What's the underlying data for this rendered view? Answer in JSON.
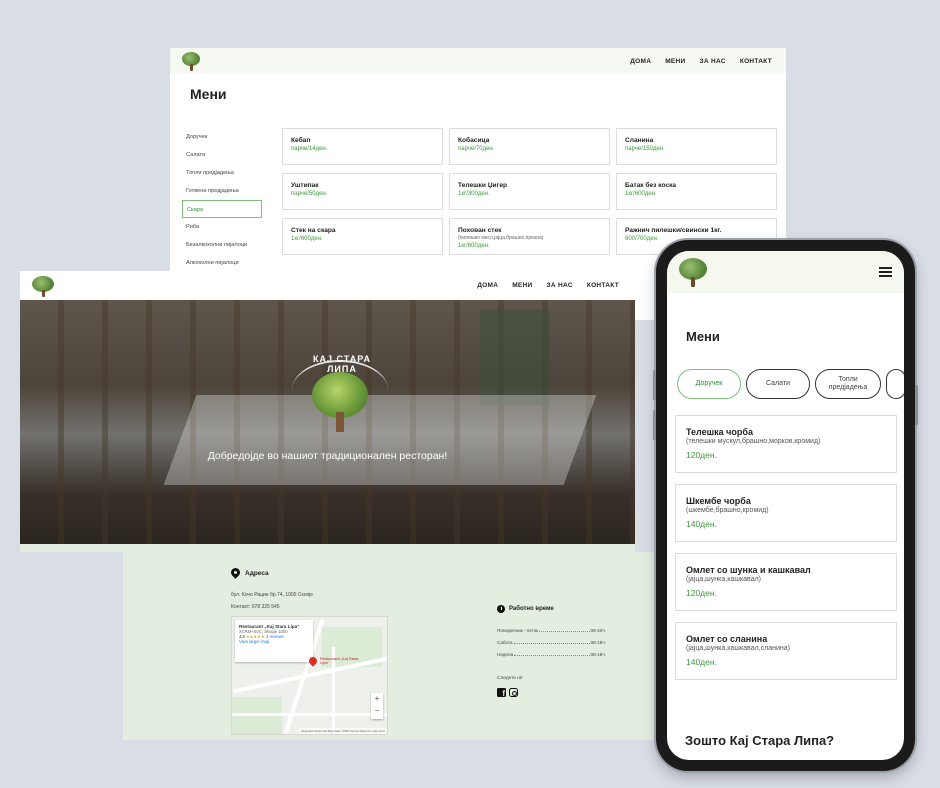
{
  "nav": [
    "ДОМА",
    "МЕНИ",
    "ЗА НАС",
    "КОНТАКТ"
  ],
  "desktop_menu": {
    "title": "Мени",
    "categories": [
      "Доручек",
      "Салати",
      "Топли предјадења",
      "Готвени предјадења",
      "Скара",
      "Риба",
      "Безалкохолни пијалоци",
      "Алкохолни пијалоци"
    ],
    "active_category": "Скара",
    "items": [
      {
        "name": "Кебап",
        "desc": "",
        "price": "парче/14ден."
      },
      {
        "name": "Кобасица",
        "desc": "",
        "price": "парче/70ден."
      },
      {
        "name": "Сланина",
        "desc": "",
        "price": "парче/150ден."
      },
      {
        "name": "Уштипак",
        "desc": "",
        "price": "парче/50ден."
      },
      {
        "name": "Телешки Џигер",
        "desc": "",
        "price": "1кг/300ден."
      },
      {
        "name": "Батак без коска",
        "desc": "",
        "price": "1кг/600ден."
      },
      {
        "name": "Стек на скара",
        "desc": "",
        "price": "1кг/600ден."
      },
      {
        "name": "Похован стек",
        "desc": "(пилешко месо,јајца,брашно,презла)",
        "price": "1кг/600ден."
      },
      {
        "name": "Ражнич пилешки/свински 1кг.",
        "desc": "",
        "price": "600/700ден."
      }
    ]
  },
  "hero": {
    "logo_text": "КАЈ СТАРА ЛИПА",
    "welcome": "Добредојде во нашиот традиционален ресторан!"
  },
  "footer": {
    "address_title": "Адреса",
    "address": "бул. Кочо Рацин бр.74, 1000 Скопје",
    "contact": "Контакт: 078 325 545",
    "map": {
      "place": "Restaurant „Kaj Stara Lipa\"",
      "place_address": "XCRM+5VC, Skopje 1000",
      "rating": "4.8",
      "stars": "★★★★★",
      "reviews": "3 reviews",
      "link": "View larger map",
      "pin_label": "Restaurant „Kaj Stara Lipa\"",
      "zoom_in": "+",
      "zoom_out": "−",
      "attribution": "Keyboard shortcuts   Map data ©2024   Terms   Report a map error"
    },
    "hours_title": "Работно време",
    "hours": [
      {
        "day": "Понеделник - петок",
        "time": "08-20ч."
      },
      {
        "day": "Сабота",
        "time": "08-18ч."
      },
      {
        "day": "Недела",
        "time": "08-18ч."
      }
    ],
    "follow": "Следете нè"
  },
  "mobile": {
    "title": "Мени",
    "tabs": [
      "Доручек",
      "Салати",
      "Топли предјадења"
    ],
    "items": [
      {
        "name": "Телешка чорба",
        "desc": "(телешки мускул,брашно,морков,кромид)",
        "price": "120ден."
      },
      {
        "name": "Шкембе чорба",
        "desc": "(шкембе,брашно,кромид)",
        "price": "140ден."
      },
      {
        "name": "Омлет со шунка и кашкавал",
        "desc": "(јајца,шунка,кашкавал)",
        "price": "120ден."
      },
      {
        "name": "Омлет со сланина",
        "desc": "(јајца,шунка,кашкавал,сланина)",
        "price": "140ден."
      }
    ],
    "why_title": "Зошто Кај Стара Липа?"
  }
}
